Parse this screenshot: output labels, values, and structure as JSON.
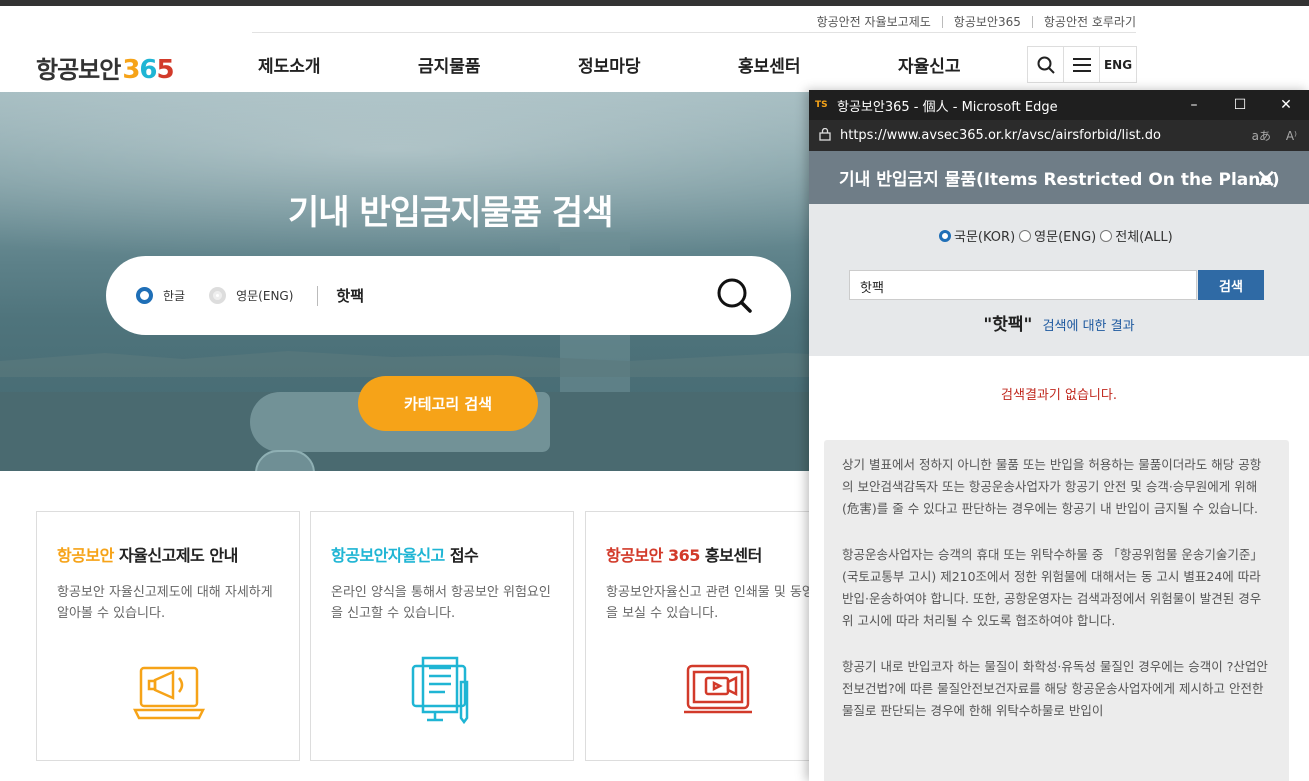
{
  "utility_links": [
    "항공안전 자율보고제도",
    "항공보안365",
    "항공안전 호루라기"
  ],
  "logo": {
    "text": "항공보안",
    "digit_3": "3",
    "digit_6": "6",
    "digit_5": "5"
  },
  "nav": [
    "제도소개",
    "금지물품",
    "정보마당",
    "홍보센터",
    "자율신고"
  ],
  "tools": {
    "search_icon": "search-icon",
    "menu_icon": "hamburger-icon",
    "lang": "ENG"
  },
  "hero": {
    "title": "기내 반입금지물품 검색",
    "radio_kor": "한글",
    "radio_eng": "영문(ENG)",
    "query": "핫팩",
    "category_button": "카테고리 검색"
  },
  "cards": [
    {
      "title_highlight": "항공보안",
      "title_rest": " 자율신고제도 안내",
      "desc": "항공보안 자율신고제도에 대해 자세하게 알아볼 수 있습니다.",
      "color": "#f6a318"
    },
    {
      "title_highlight": "항공보안자율신고",
      "title_rest": " 접수",
      "desc": "온라인 양식을 통해서 항공보안 위험요인을 신고할 수 있습니다.",
      "color": "#1fb5d4"
    },
    {
      "title_highlight": "항공보안 365",
      "title_rest": " 홍보센터",
      "desc": "항공보안자율신고 관련 인쇄물 및 동영상을 보실 수 있습니다.",
      "color": "#d23a2a"
    }
  ],
  "popup": {
    "window_title": "항공보안365 - 個人 - Microsoft Edge",
    "app_badge": "TS",
    "url": "https://www.avsec365.or.kr/avsc/airsforbid/list.do",
    "header": "기내 반입금지 물품(Items Restricted On the Plane)",
    "radios": [
      "국문(KOR)",
      "영문(ENG)",
      "전체(ALL)"
    ],
    "input_value": "핫팩",
    "search_button": "검색",
    "result_term": "\"핫팩\"",
    "result_suffix": "검색에 대한 결과",
    "no_result": "검색결과기 없습니다.",
    "notice": [
      "상기 별표에서 정하지 아니한 물품 또는 반입을 허용하는 물품이더라도 해당 공항의 보안검색감독자 또는 항공운송사업자가 항공기 안전 및 승객·승무원에게 위해(危害)를 줄 수 있다고 판단하는 경우에는 항공기 내 반입이 금지될 수 있습니다.",
      "항공운송사업자는 승객의 휴대 또는 위탁수하물 중 「항공위험물 운송기술기준」(국토교통부 고시) 제210조에서 정한 위험물에 대해서는 동 고시 별표24에 따라 반입·운송하여야 합니다. 또한, 공항운영자는 검색과정에서 위험물이 발견된 경우 위 고시에 따라 처리될 수 있도록 협조하여야 합니다.",
      "항공기 내로 반입코자 하는 물질이 화학성·유독성 물질인 경우에는 승객이 ?산업안전보건법?에 따른 물질안전보건자료를 해당 항공운송사업자에게 제시하고 안전한 물질로 판단되는 경우에 한해 위탁수하물로 반입이"
    ]
  }
}
